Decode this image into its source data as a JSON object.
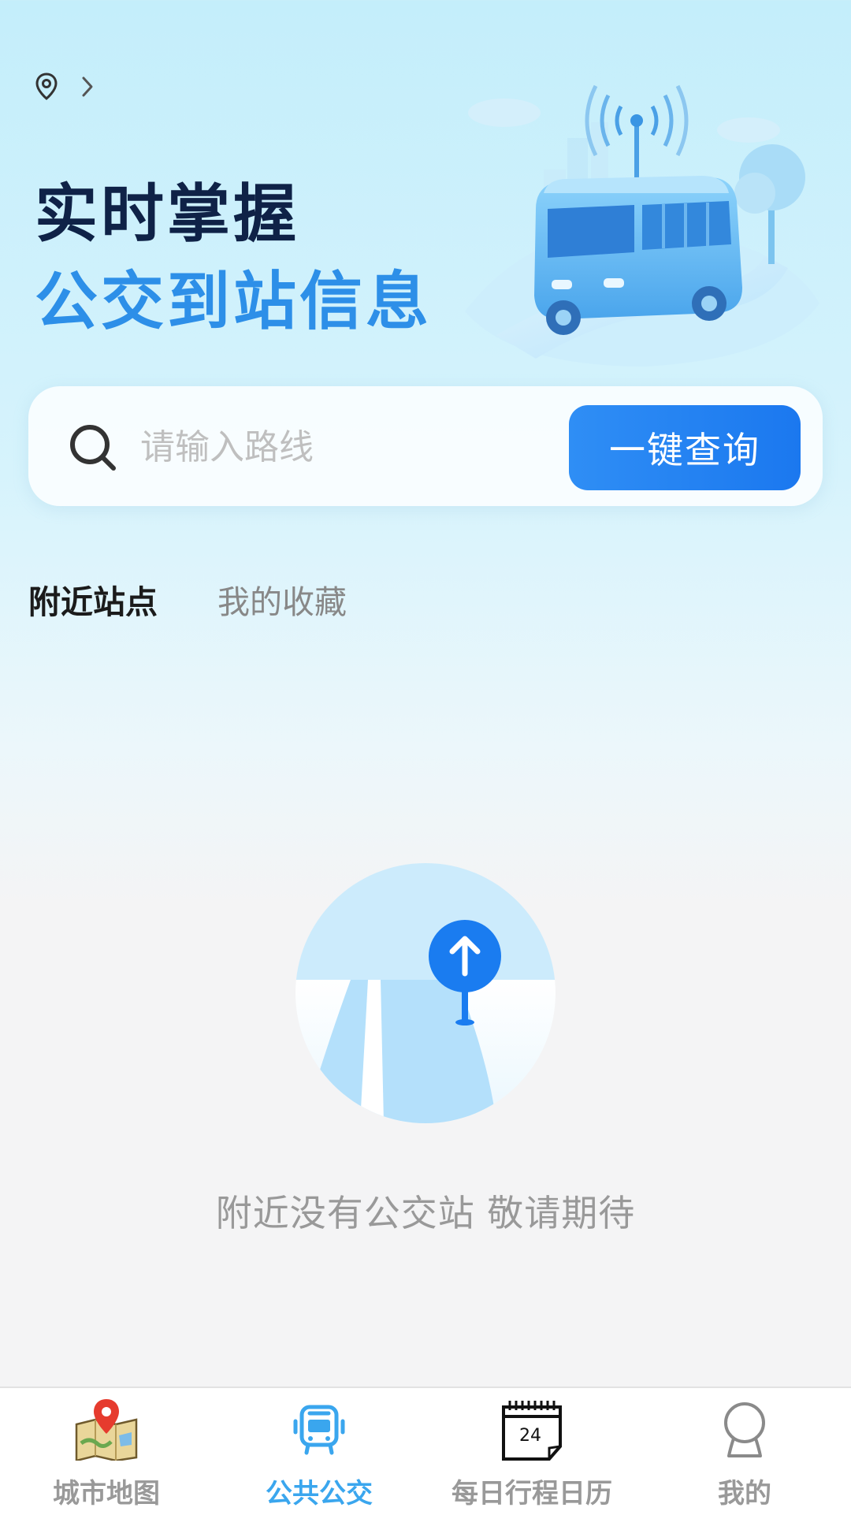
{
  "header": {
    "location_text": "",
    "icons": [
      "location-pin-icon",
      "chevron-right-icon"
    ]
  },
  "hero": {
    "line1": "实时掌握",
    "line2": "公交到站信息",
    "illustration": "bus-signal-illustration"
  },
  "search": {
    "placeholder": "请输入路线",
    "value": "",
    "button_label": "一键查询",
    "icon": "search-icon"
  },
  "tabs": [
    {
      "label": "附近站点",
      "active": true
    },
    {
      "label": "我的收藏",
      "active": false
    }
  ],
  "empty_state": {
    "message": "附近没有公交站 敬请期待",
    "illustration": "road-sign-illustration"
  },
  "bottom_nav": [
    {
      "label": "城市地图",
      "icon": "map-pin-icon",
      "active": false
    },
    {
      "label": "公共公交",
      "icon": "bus-icon",
      "active": true
    },
    {
      "label": "每日行程日历",
      "icon": "calendar-icon",
      "active": false,
      "icon_text": "24"
    },
    {
      "label": "我的",
      "icon": "profile-icon",
      "active": false
    }
  ],
  "colors": {
    "primary": "#1b78ef",
    "title_dark": "#0f2247",
    "title_blue": "#2d8fe8",
    "nav_active": "#3aa6ee",
    "muted": "#999999"
  }
}
